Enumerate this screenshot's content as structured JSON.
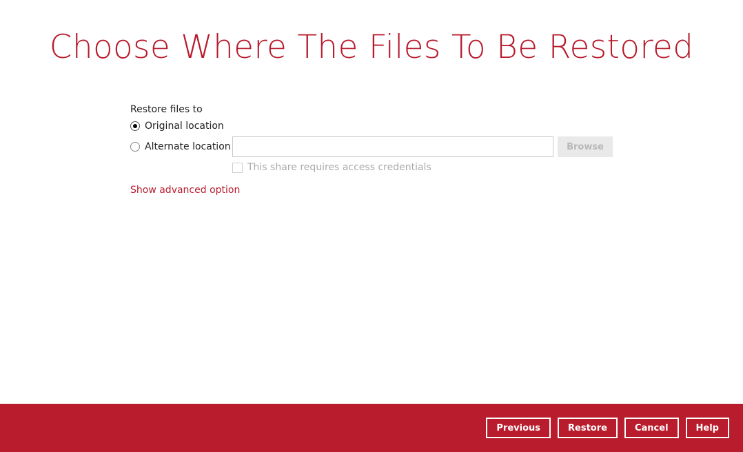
{
  "page": {
    "title": "Choose Where The Files To Be Restored"
  },
  "restore": {
    "section_label": "Restore files to",
    "options": [
      {
        "label": "Original location",
        "checked": true
      },
      {
        "label": "Alternate location",
        "checked": false
      }
    ],
    "alternate_path": {
      "value": "",
      "placeholder": ""
    },
    "browse_label": "Browse",
    "credentials_label": "This share requires access credentials",
    "advanced_link": "Show advanced option"
  },
  "footer": {
    "buttons": {
      "previous": "Previous",
      "restore": "Restore",
      "cancel": "Cancel",
      "help": "Help"
    }
  },
  "colors": {
    "accent": "#b71c2e",
    "footer_bg": "#b91c2c",
    "disabled_text": "#a9a9a9"
  }
}
